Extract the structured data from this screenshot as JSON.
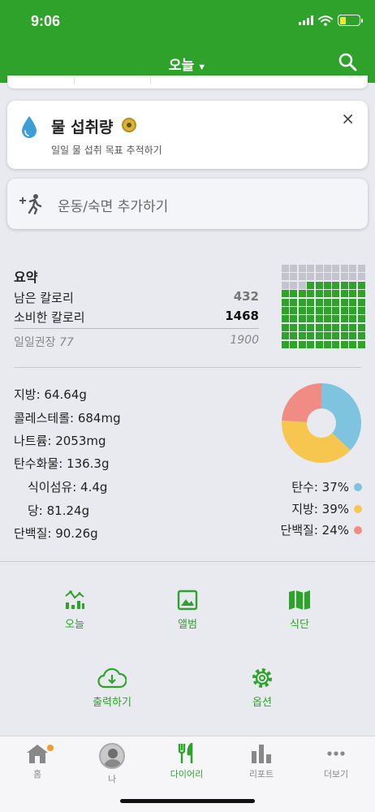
{
  "status": {
    "time": "9:06"
  },
  "nav": {
    "title": "오늘"
  },
  "water": {
    "title": "물 섭취량",
    "subtitle": "일일 물 섭취 목표 추적하기",
    "close": "×"
  },
  "exercise": {
    "label": "운동/숙면 추가하기"
  },
  "summary": {
    "title": "요약",
    "remaining_label": "남은 칼로리",
    "remaining_value": "432",
    "burned_label": "소비한 칼로리",
    "burned_value": "1468",
    "daily_label": "일일권장",
    "daily_extra": "77",
    "daily_value": "1900",
    "grid_filled_fraction": 0.77
  },
  "nutrients": [
    {
      "label": "지방: 64.64g"
    },
    {
      "label": "콜레스테롤: 684mg"
    },
    {
      "label": "나트륨: 2053mg"
    },
    {
      "label": "탄수화물: 136.3g"
    },
    {
      "label": "식이섬유: 4.4g"
    },
    {
      "label": "당: 81.24g"
    },
    {
      "label": "단백질: 90.26g"
    }
  ],
  "macro_legend": [
    {
      "label": "탄수: 37%",
      "color": "#7ec4de"
    },
    {
      "label": "지방: 39%",
      "color": "#f7c64f"
    },
    {
      "label": "단백질: 24%",
      "color": "#f08c84"
    }
  ],
  "chart_data": {
    "type": "pie",
    "categories": [
      "탄수",
      "지방",
      "단백질"
    ],
    "values": [
      37,
      39,
      24
    ],
    "colors": [
      "#7ec4de",
      "#f7c64f",
      "#f08c84"
    ]
  },
  "actions": {
    "today": "오늘",
    "album": "앨범",
    "meals": "식단",
    "export": "출력하기",
    "options": "옵션"
  },
  "tabs": {
    "home": "홈",
    "me": "나",
    "diary": "다이어리",
    "report": "리포트",
    "more": "더보기"
  },
  "colors": {
    "brand": "#2ea22a",
    "grid_filled": "#2ea22a",
    "grid_empty": "#c4c4cc"
  }
}
